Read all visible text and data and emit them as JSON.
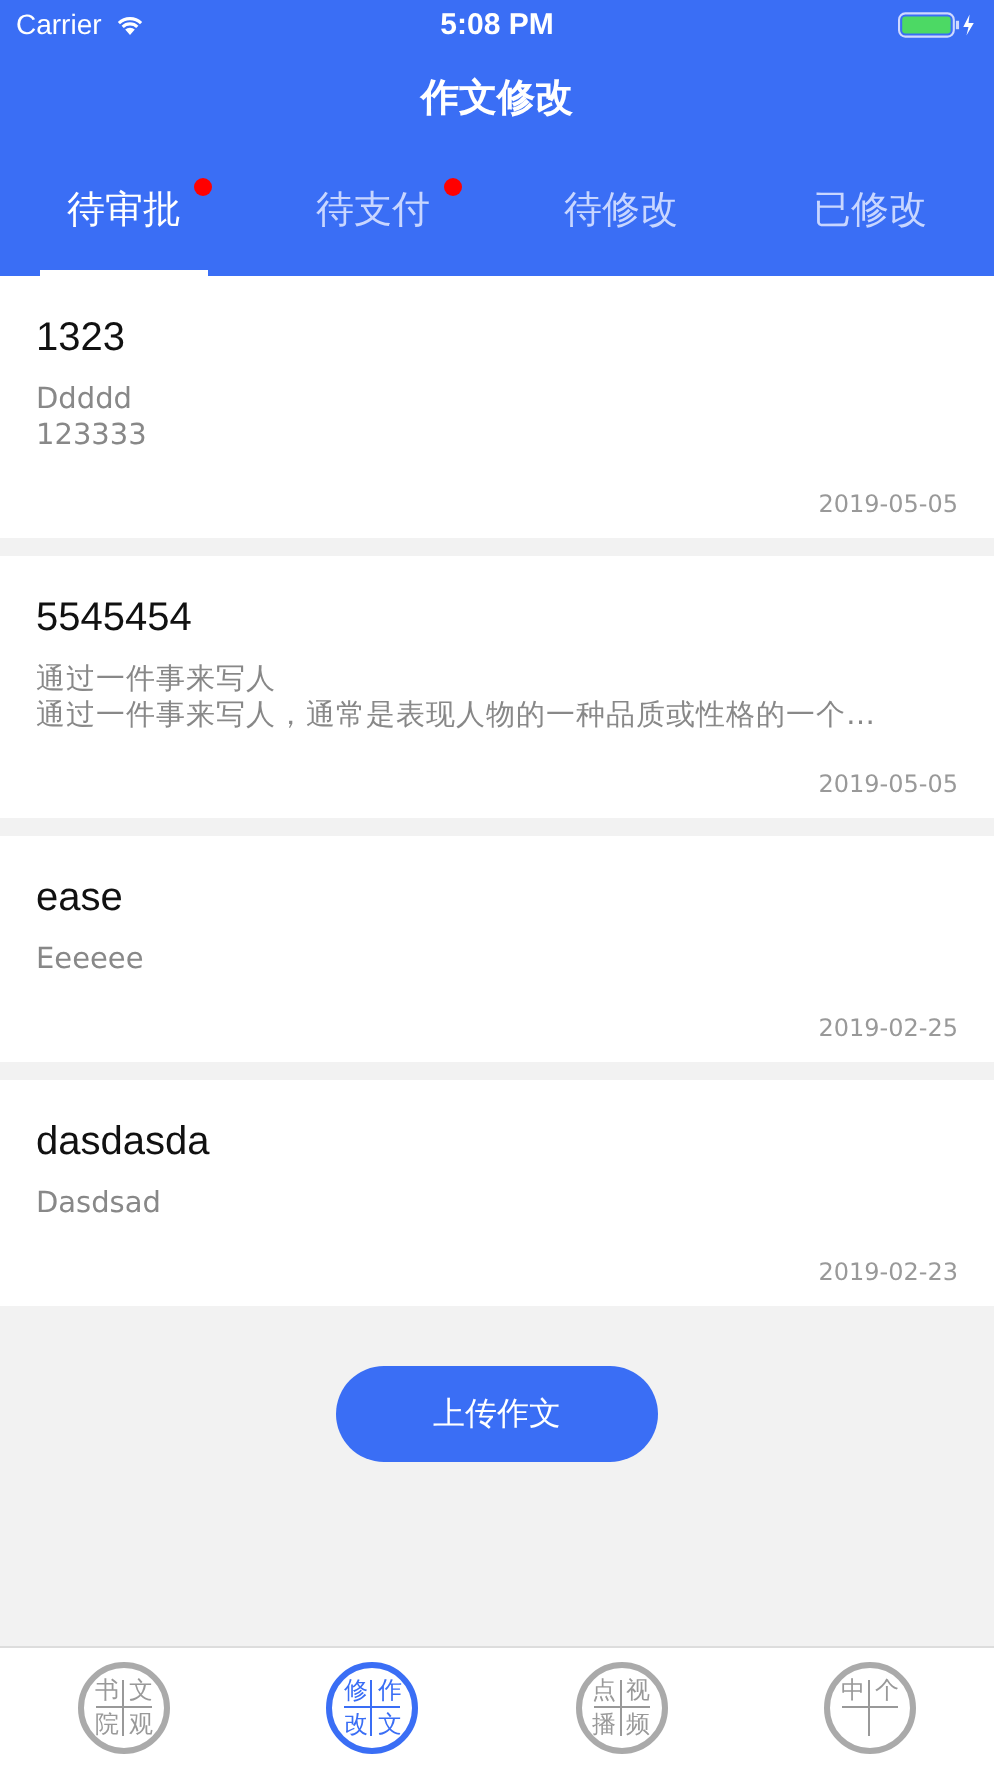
{
  "status_bar": {
    "carrier": "Carrier",
    "time": "5:08 PM",
    "battery_charging": true
  },
  "header": {
    "title": "作文修改"
  },
  "tabs": [
    {
      "label": "待审批",
      "selected": true,
      "badge": true
    },
    {
      "label": "待支付",
      "selected": false,
      "badge": true
    },
    {
      "label": "待修改",
      "selected": false,
      "badge": false
    },
    {
      "label": "已修改",
      "selected": false,
      "badge": false
    }
  ],
  "essays": [
    {
      "title": "1323",
      "lines": [
        "Ddddd",
        "123333"
      ],
      "date": "2019-05-05"
    },
    {
      "title": "5545454",
      "lines": [
        "通过一件事来写人",
        "通过一件事来写人，通常是表现人物的一种品质或性格的一个…"
      ],
      "date": "2019-05-05"
    },
    {
      "title": "ease",
      "lines": [
        "Eeeeee"
      ],
      "date": "2019-02-25"
    },
    {
      "title": "dasdasda",
      "lines": [
        "Dasdsad"
      ],
      "date": "2019-02-23"
    }
  ],
  "upload_button": "上传作文",
  "tab_bar": [
    {
      "chars": [
        "书",
        "文",
        "院",
        "观"
      ],
      "selected": false
    },
    {
      "chars": [
        "修",
        "作",
        "改",
        "文"
      ],
      "selected": true
    },
    {
      "chars": [
        "点",
        "视",
        "播",
        "频"
      ],
      "selected": false
    },
    {
      "chars": [
        "中",
        "个"
      ],
      "selected": false
    }
  ]
}
